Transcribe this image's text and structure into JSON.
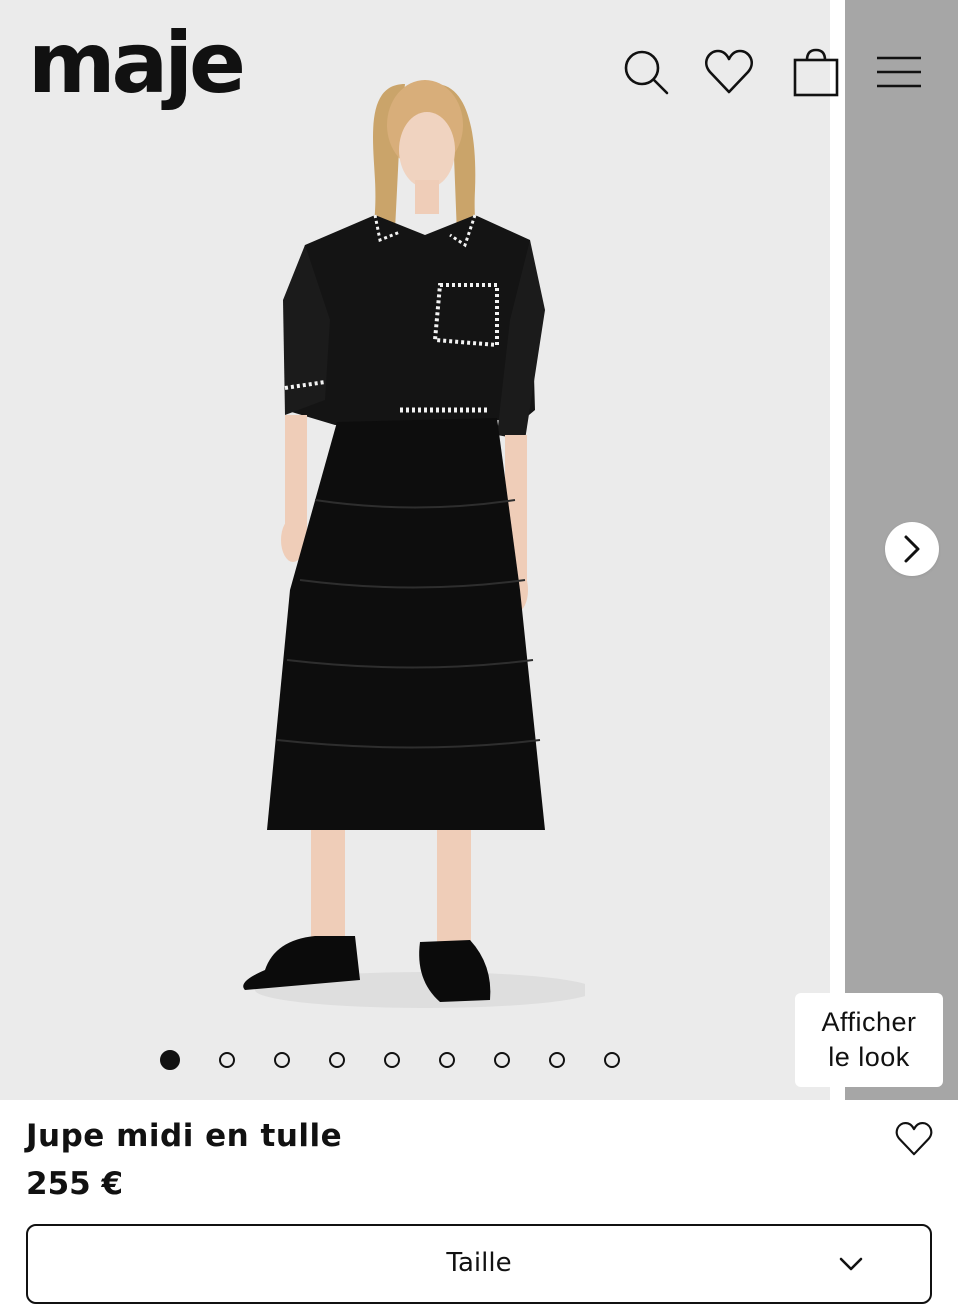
{
  "header": {
    "logo_text": "maje",
    "icons": [
      "search-icon",
      "heart-icon",
      "shopping-bag-icon",
      "hamburger-menu-icon"
    ]
  },
  "gallery": {
    "slide_count": 9,
    "active_slide": 1,
    "next_icon": "chevron-right-icon",
    "look_button_lines": [
      "Afficher",
      "le look"
    ]
  },
  "product": {
    "title": "Jupe midi en tulle",
    "price": "255 €",
    "wishlist_icon": "heart-icon"
  },
  "size_selector": {
    "label": "Taille",
    "icon": "chevron-down-icon"
  },
  "colors": {
    "gallery_bg": "#ebebeb",
    "next_slide_bg": "#a6a6a6",
    "text": "#111111"
  }
}
